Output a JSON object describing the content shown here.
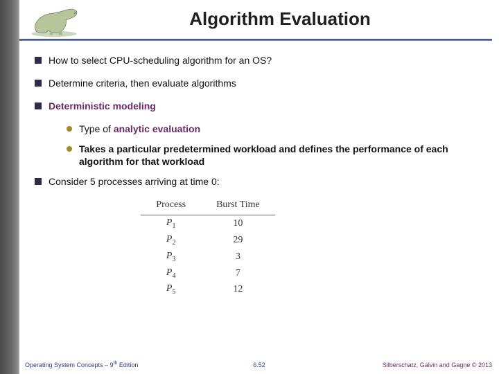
{
  "slide": {
    "title": "Algorithm Evaluation",
    "bullets": {
      "b1": "How to select CPU-scheduling algorithm for an OS?",
      "b2": "Determine criteria, then evaluate algorithms",
      "b3": "Deterministic modeling",
      "b3s1_prefix": "Type of ",
      "b3s1_accent": "analytic evaluation",
      "b3s2": "Takes a particular predetermined workload and defines the performance of each algorithm  for that workload",
      "b4": "Consider 5 processes arriving at time 0:"
    }
  },
  "chart_data": {
    "type": "table",
    "title": "",
    "columns": [
      "Process",
      "Burst Time"
    ],
    "rows": [
      {
        "process": "P1",
        "burst": 10
      },
      {
        "process": "P2",
        "burst": 29
      },
      {
        "process": "P3",
        "burst": 3
      },
      {
        "process": "P4",
        "burst": 7
      },
      {
        "process": "P5",
        "burst": 12
      }
    ]
  },
  "footer": {
    "left_a": "Operating System Concepts – 9",
    "left_sup": "th",
    "left_b": " Edition",
    "mid": "6.52",
    "right": "Silberschatz, Galvin and Gagne © 2013"
  },
  "icons": {
    "logo": "dinosaur-logo"
  },
  "colors": {
    "accent": "#6a2a66",
    "rule": "#2a3a6a",
    "bullet_square": "#2b2b4a",
    "bullet_dot": "#a08a2a"
  }
}
